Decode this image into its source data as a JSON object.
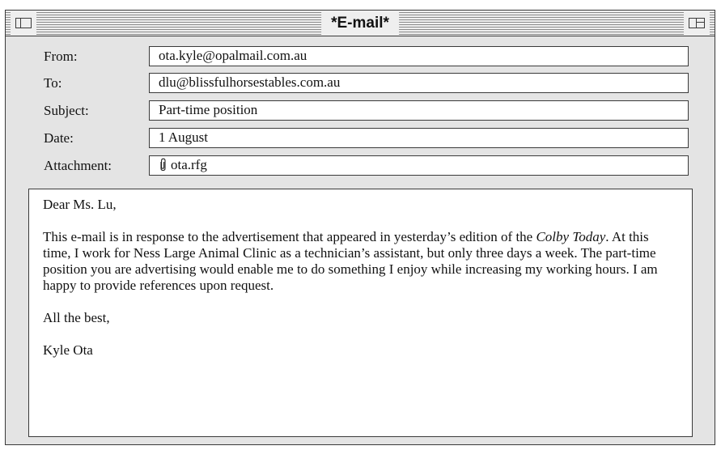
{
  "window": {
    "title": "*E-mail*"
  },
  "header": {
    "from": {
      "label": "From:",
      "value": "ota.kyle@opalmail.com.au"
    },
    "to": {
      "label": "To:",
      "value": "dlu@blissfulhorsestables.com.au"
    },
    "subject": {
      "label": "Subject:",
      "value": "Part-time position"
    },
    "date": {
      "label": "Date:",
      "value": "1 August"
    },
    "attachment": {
      "label": "Attachment:",
      "value": "ota.rfg",
      "icon": "paperclip-icon"
    }
  },
  "message": {
    "greeting": "Dear Ms. Lu,",
    "paragraph_before": "This e-mail is in response to the advertisement that appeared in yesterday’s edition of the ",
    "publication": "Colby Today",
    "paragraph_after": ". At this time, I work for Ness Large Animal Clinic as a technician’s assistant, but only three days a week. The part-time position you are advertising would enable me to do something I enjoy while increasing my working hours. I am happy to provide references upon request.",
    "closing": "All the best,",
    "signature": "Kyle Ota"
  }
}
